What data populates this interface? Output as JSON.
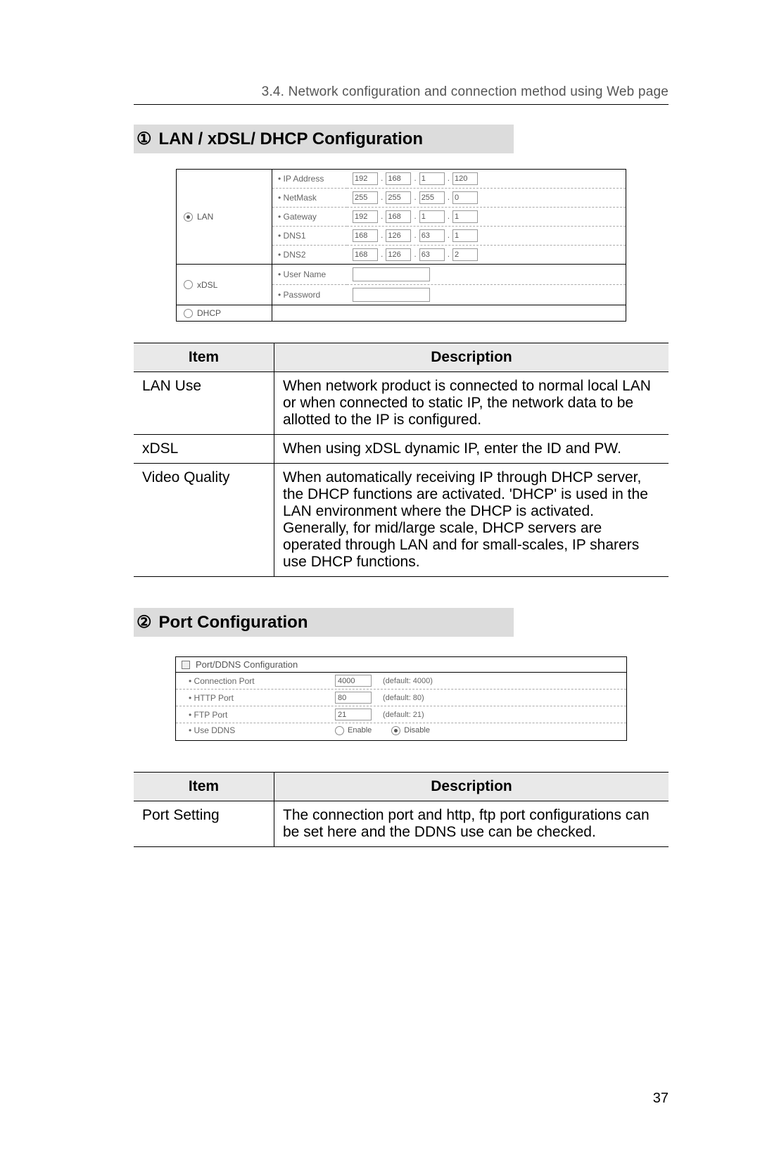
{
  "header": "3.4. Network configuration and connection method using Web page",
  "section1": {
    "num": "①",
    "title": "LAN / xDSL/ DHCP Configuration"
  },
  "lanForm": {
    "lan_label": "LAN",
    "xdsl_label": "xDSL",
    "dhcp_label": "DHCP",
    "ip_label": "• IP Address",
    "netmask_label": "• NetMask",
    "gateway_label": "• Gateway",
    "dns1_label": "• DNS1",
    "dns2_label": "• DNS2",
    "user_label": "• User Name",
    "pass_label": "• Password",
    "ip": [
      "192",
      "168",
      "1",
      "120"
    ],
    "netmask": [
      "255",
      "255",
      "255",
      "0"
    ],
    "gateway": [
      "192",
      "168",
      "1",
      "1"
    ],
    "dns1": [
      "168",
      "126",
      "63",
      "1"
    ],
    "dns2": [
      "168",
      "126",
      "63",
      "2"
    ]
  },
  "table1": {
    "h_item": "Item",
    "h_desc": "Description",
    "rows": [
      {
        "item": "LAN Use",
        "desc": "When network product is connected to normal local LAN or when connected to static IP, the network data to be allotted to the IP is configured."
      },
      {
        "item": "xDSL",
        "desc": "When using xDSL dynamic IP, enter the ID and PW."
      },
      {
        "item": "Video Quality",
        "desc": "When automatically receiving IP through DHCP server, the DHCP functions are activated. 'DHCP' is used in the LAN environment where the DHCP is activated. Generally, for mid/large scale, DHCP servers are operated through LAN and for small-scales, IP sharers use DHCP functions."
      }
    ]
  },
  "section2": {
    "num": "②",
    "title": "Port Configuration"
  },
  "portForm": {
    "panel_title": "Port/DDNS Configuration",
    "conn_label": "• Connection Port",
    "conn_val": "4000",
    "conn_hint": "(default: 4000)",
    "http_label": "• HTTP Port",
    "http_val": "80",
    "http_hint": "(default: 80)",
    "ftp_label": "• FTP Port",
    "ftp_val": "21",
    "ftp_hint": "(default: 21)",
    "ddns_label": "• Use DDNS",
    "enable": "Enable",
    "disable": "Disable"
  },
  "table2": {
    "h_item": "Item",
    "h_desc": "Description",
    "rows": [
      {
        "item": "Port Setting",
        "desc": "The connection port and http, ftp port configurations can be set here and the DDNS use can be checked."
      }
    ]
  },
  "page_number": "37"
}
